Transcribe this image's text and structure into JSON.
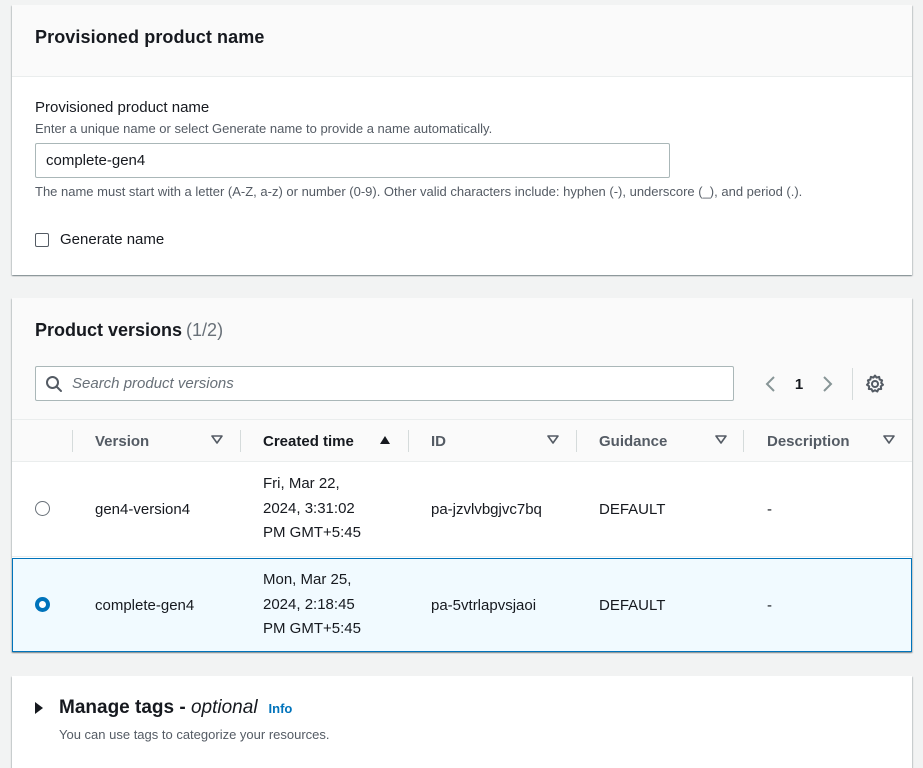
{
  "name_section": {
    "title": "Provisioned product name",
    "field_label": "Provisioned product name",
    "description": "Enter a unique name or select Generate name to provide a name automatically.",
    "input_value": "complete-gen4",
    "constraint": "The name must start with a letter (A-Z, a-z) or number (0-9). Other valid characters include: hyphen (-), underscore (_), and period (.).",
    "generate_label": "Generate name",
    "generate_checked": false
  },
  "versions_section": {
    "title": "Product versions",
    "count": "(1/2)",
    "search_placeholder": "Search product versions",
    "page": "1",
    "columns": [
      "Version",
      "Created time",
      "ID",
      "Guidance",
      "Description"
    ],
    "sorted_column": "Created time",
    "sort_direction": "ascending",
    "rows": [
      {
        "selected": false,
        "version": "gen4-version4",
        "created_lines": [
          "Fri, Mar 22,",
          "2024, 3:31:02",
          "PM GMT+5:45"
        ],
        "id": "pa-jzvlvbgjvc7bq",
        "guidance": "DEFAULT",
        "description": "-"
      },
      {
        "selected": true,
        "version": "complete-gen4",
        "created_lines": [
          "Mon, Mar 25,",
          "2024, 2:18:45",
          "PM GMT+5:45"
        ],
        "id": "pa-5vtrlapvsjaoi",
        "guidance": "DEFAULT",
        "description": "-"
      }
    ]
  },
  "tags_section": {
    "title": "Manage tags - ",
    "optional": "optional",
    "info": "Info",
    "description": "You can use tags to categorize your resources."
  },
  "colors": {
    "accent": "#0073bb",
    "selected_row_bg": "#f1faff",
    "page_bg": "#f2f3f3",
    "text_primary": "#16191f",
    "text_secondary": "#545b64"
  }
}
